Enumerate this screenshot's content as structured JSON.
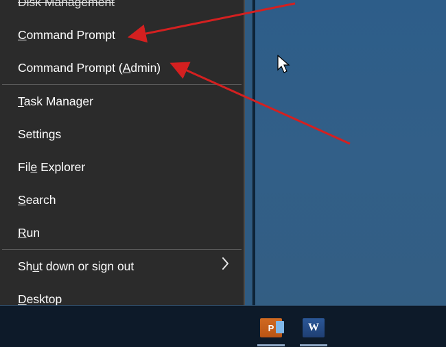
{
  "menu": {
    "items": [
      {
        "pre": "",
        "akey": "",
        "post": "Disk Management"
      },
      {
        "pre": "",
        "akey": "C",
        "post": "ommand Prompt"
      },
      {
        "pre": "Command Prompt (",
        "akey": "A",
        "post": "dmin)"
      },
      {
        "pre": "",
        "akey": "T",
        "post": "ask Manager"
      },
      {
        "pre": "Settin",
        "akey": "g",
        "post": "s"
      },
      {
        "pre": "Fil",
        "akey": "e",
        "post": " Explorer"
      },
      {
        "pre": "",
        "akey": "S",
        "post": "earch"
      },
      {
        "pre": "",
        "akey": "R",
        "post": "un"
      },
      {
        "pre": "Sh",
        "akey": "u",
        "post": "t down or sign out"
      },
      {
        "pre": "",
        "akey": "D",
        "post": "esktop"
      }
    ]
  },
  "taskbar": {
    "app1_label": "P",
    "app2_label": "W"
  },
  "annotations": {
    "arrow1_target": "Command Prompt",
    "arrow2_target": "Command Prompt (Admin)",
    "arrow_color": "#d42020"
  }
}
